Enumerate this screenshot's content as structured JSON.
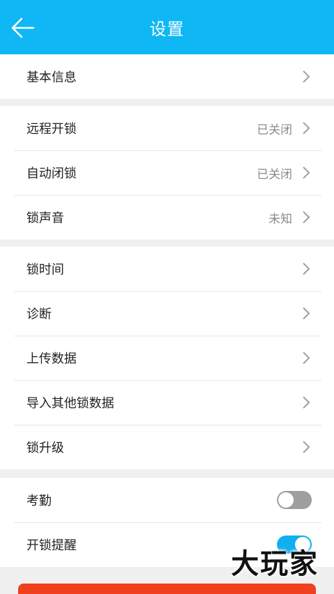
{
  "header": {
    "title": "设置"
  },
  "group1": [
    {
      "label": "基本信息",
      "value": ""
    }
  ],
  "group2": [
    {
      "label": "远程开锁",
      "value": "已关闭"
    },
    {
      "label": "自动闭锁",
      "value": "已关闭"
    },
    {
      "label": "锁声音",
      "value": "未知"
    }
  ],
  "group3": [
    {
      "label": "锁时间"
    },
    {
      "label": "诊断"
    },
    {
      "label": "上传数据"
    },
    {
      "label": "导入其他锁数据"
    },
    {
      "label": "锁升级"
    }
  ],
  "group4": [
    {
      "label": "考勤",
      "toggle": "off"
    },
    {
      "label": "开锁提醒",
      "toggle": "on"
    }
  ],
  "watermark": "大玩家",
  "colors": {
    "header": "#0fb7f5",
    "toggle_on": "#11aef0",
    "danger": "#f0401e"
  }
}
